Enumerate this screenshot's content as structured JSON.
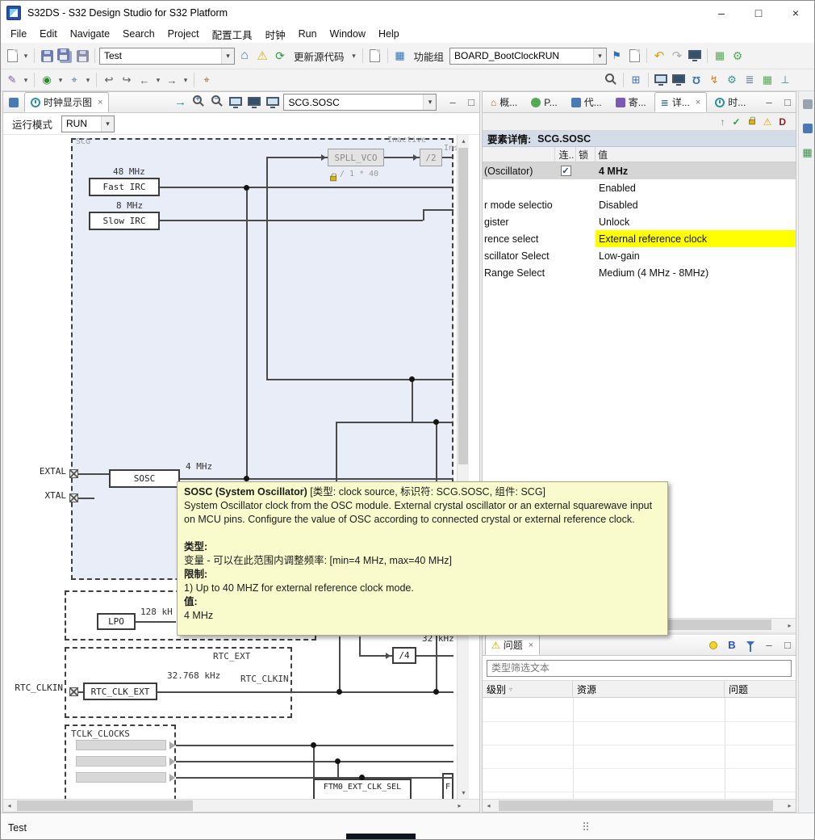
{
  "window": {
    "title": "S32DS - S32 Design Studio for S32 Platform"
  },
  "icons": {
    "dropdown": "▾",
    "minimize": "–",
    "maximize": "□",
    "close": "×",
    "home": "⌂",
    "warning": "⚠",
    "flag": "⚑",
    "undo": "↶",
    "redo": "↷",
    "back": "←",
    "forward": "→",
    "back_history": "↩",
    "forward_history": "↪",
    "refresh": "⟳",
    "pencil": "✎",
    "grid": "▦",
    "table": "⊞",
    "rows": "▤",
    "pins": "Ʊ",
    "lightning": "↯",
    "gear": "⚙",
    "list": "≣",
    "ground": "⊥",
    "up_arrow": "↑",
    "check": "✓",
    "letter_d": "D",
    "letter_b": "B",
    "go_into": "→",
    "left": "◂",
    "right": "▸",
    "up": "▴",
    "down": "▾",
    "sort": "▿",
    "run_icon": "◉",
    "pin_marker": "⌖"
  },
  "menubar": {
    "items": [
      "File",
      "Edit",
      "Navigate",
      "Search",
      "Project",
      "配置工具",
      "时钟",
      "Run",
      "Window",
      "Help"
    ]
  },
  "toolbar1": {
    "test_value": "Test",
    "update_label": "更新源代码",
    "group_label": "功能组",
    "board_value": "BOARD_BootClockRUN"
  },
  "editor": {
    "tab": "时钟显示图",
    "run_mode_label": "运行模式",
    "run_mode_value": "RUN",
    "element_value": "SCG.SOSC"
  },
  "diagram": {
    "scg": "SCG",
    "fast_irc": "Fast IRC",
    "fast_irc_freq": "48 MHz",
    "slow_irc": "Slow IRC",
    "slow_irc_freq": "8 MHz",
    "spll_vco": "SPLL_VCO",
    "spll_note": "Inactive",
    "spll_cut": "Ins",
    "spll_mult": "/ 1 * 40",
    "div2": "/2",
    "sosc": "SOSC",
    "sosc_freq": "4 MHz",
    "extal": "EXTAL",
    "xtal": "XTAL",
    "lpo": "LPO",
    "lpo_freq": "128 kH",
    "rtc_region": "RTC_EXT",
    "rtc_box": "RTC_CLK_EXT",
    "rtc_freq": "32.768 kHz",
    "rtc_signal": "RTC_CLKIN",
    "rtc_port": "RTC_CLKIN",
    "div4": "/4",
    "div4_freq": "32 kHz",
    "tclk_region": "TCLK_CLOCKS",
    "ftm0": "FTM0_EXT_CLK_SEL",
    "cut_box": "F"
  },
  "tooltip": {
    "title": "SOSC (System Oscillator)",
    "meta": " [类型: clock source, 标识符: SCG.SOSC, 组件: SCG]",
    "body": "System Oscillator clock from the OSC module. External crystal oscillator or an external squarewave input on MCU pins. Configure the value of OSC according to connected crystal or external reference clock.",
    "type_label": "类型:",
    "type_text": "变量 - 可以在此范围内调整频率: [min=4 MHz, max=40 MHz]",
    "constraint_label": "限制:",
    "constraint_text": "1) Up to 40 MHZ for external reference clock mode.",
    "value_label": "值:",
    "value_text": "4 MHz"
  },
  "details": {
    "tabs": [
      "概...",
      "P...",
      "代...",
      "寄...",
      "详...",
      "时..."
    ],
    "header_label": "要素详情:",
    "header_value": "SCG.SOSC",
    "col_conn": "连..",
    "col_lock": "锁",
    "col_value": "值",
    "rows": [
      {
        "name": "(Oscillator)",
        "value": "4 MHz"
      },
      {
        "name": "",
        "value": "Enabled"
      },
      {
        "name": "r mode selectio",
        "value": "Disabled"
      },
      {
        "name": "gister",
        "value": "Unlock"
      },
      {
        "name": "rence select",
        "value": "External reference clock"
      },
      {
        "name": "scillator Select",
        "value": "Low-gain"
      },
      {
        "name": "Range Select",
        "value": "Medium (4 MHz - 8MHz)"
      }
    ]
  },
  "problems": {
    "tab": "问题",
    "filter_placeholder": "类型筛选文本",
    "col_level": "级别",
    "col_resource": "资源",
    "col_problem": "问题"
  },
  "statusbar": {
    "text": "Test"
  }
}
